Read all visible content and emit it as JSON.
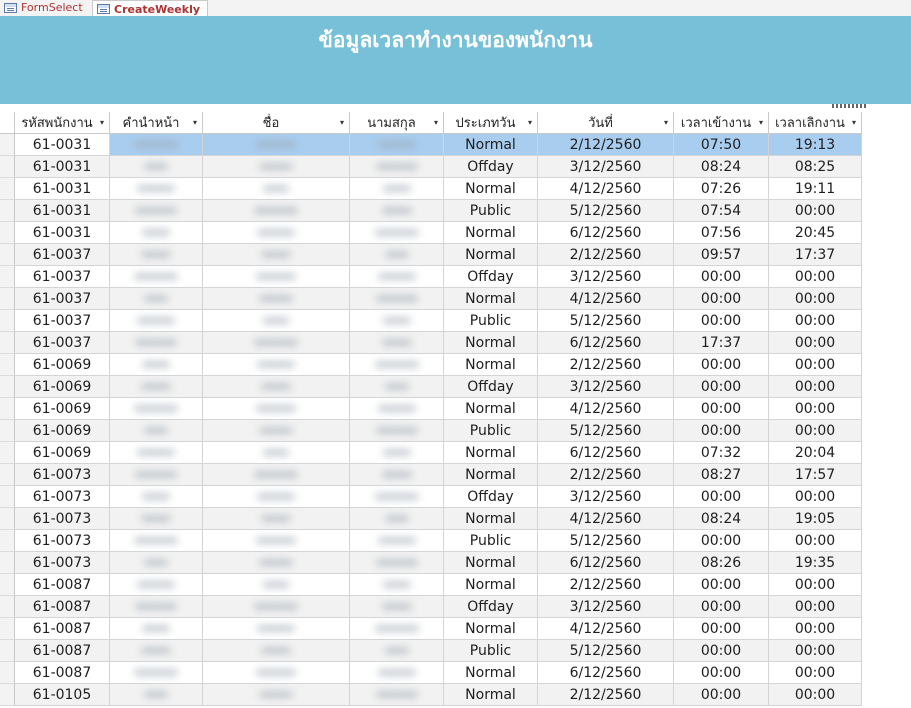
{
  "tabs": [
    {
      "label": "FormSelect",
      "active": false
    },
    {
      "label": "CreateWeekly",
      "active": true
    }
  ],
  "header": {
    "title": "ข้อมูลเวลาทำงานของพนักงาน",
    "background": "#78c0d7"
  },
  "columns": [
    "รหัสพนักงาน",
    "คำนำหน้า",
    "ชื่อ",
    "นามสกุล",
    "ประเภทวัน",
    "วันที่",
    "เวลาเข้างาน",
    "เวลาเลิกงาน"
  ],
  "rows": [
    {
      "id": "61-0031",
      "type": "Normal",
      "date": "2/12/2560",
      "in": "07:50",
      "out": "19:13"
    },
    {
      "id": "61-0031",
      "type": "Offday",
      "date": "3/12/2560",
      "in": "08:24",
      "out": "08:25"
    },
    {
      "id": "61-0031",
      "type": "Normal",
      "date": "4/12/2560",
      "in": "07:26",
      "out": "19:11"
    },
    {
      "id": "61-0031",
      "type": "Public",
      "date": "5/12/2560",
      "in": "07:54",
      "out": "00:00"
    },
    {
      "id": "61-0031",
      "type": "Normal",
      "date": "6/12/2560",
      "in": "07:56",
      "out": "20:45"
    },
    {
      "id": "61-0037",
      "type": "Normal",
      "date": "2/12/2560",
      "in": "09:57",
      "out": "17:37"
    },
    {
      "id": "61-0037",
      "type": "Offday",
      "date": "3/12/2560",
      "in": "00:00",
      "out": "00:00"
    },
    {
      "id": "61-0037",
      "type": "Normal",
      "date": "4/12/2560",
      "in": "00:00",
      "out": "00:00"
    },
    {
      "id": "61-0037",
      "type": "Public",
      "date": "5/12/2560",
      "in": "00:00",
      "out": "00:00"
    },
    {
      "id": "61-0037",
      "type": "Normal",
      "date": "6/12/2560",
      "in": "17:37",
      "out": "00:00"
    },
    {
      "id": "61-0069",
      "type": "Normal",
      "date": "2/12/2560",
      "in": "00:00",
      "out": "00:00"
    },
    {
      "id": "61-0069",
      "type": "Offday",
      "date": "3/12/2560",
      "in": "00:00",
      "out": "00:00"
    },
    {
      "id": "61-0069",
      "type": "Normal",
      "date": "4/12/2560",
      "in": "00:00",
      "out": "00:00"
    },
    {
      "id": "61-0069",
      "type": "Public",
      "date": "5/12/2560",
      "in": "00:00",
      "out": "00:00"
    },
    {
      "id": "61-0069",
      "type": "Normal",
      "date": "6/12/2560",
      "in": "07:32",
      "out": "20:04"
    },
    {
      "id": "61-0073",
      "type": "Normal",
      "date": "2/12/2560",
      "in": "08:27",
      "out": "17:57"
    },
    {
      "id": "61-0073",
      "type": "Offday",
      "date": "3/12/2560",
      "in": "00:00",
      "out": "00:00"
    },
    {
      "id": "61-0073",
      "type": "Normal",
      "date": "4/12/2560",
      "in": "08:24",
      "out": "19:05"
    },
    {
      "id": "61-0073",
      "type": "Public",
      "date": "5/12/2560",
      "in": "00:00",
      "out": "00:00"
    },
    {
      "id": "61-0073",
      "type": "Normal",
      "date": "6/12/2560",
      "in": "08:26",
      "out": "19:35"
    },
    {
      "id": "61-0087",
      "type": "Normal",
      "date": "2/12/2560",
      "in": "00:00",
      "out": "00:00"
    },
    {
      "id": "61-0087",
      "type": "Offday",
      "date": "3/12/2560",
      "in": "00:00",
      "out": "00:00"
    },
    {
      "id": "61-0087",
      "type": "Normal",
      "date": "4/12/2560",
      "in": "00:00",
      "out": "00:00"
    },
    {
      "id": "61-0087",
      "type": "Public",
      "date": "5/12/2560",
      "in": "00:00",
      "out": "00:00"
    },
    {
      "id": "61-0087",
      "type": "Normal",
      "date": "6/12/2560",
      "in": "00:00",
      "out": "00:00"
    },
    {
      "id": "61-0105",
      "type": "Normal",
      "date": "2/12/2560",
      "in": "00:00",
      "out": "00:00"
    }
  ],
  "colors": {
    "selected_row": "#a9cdef",
    "alt_row": "#f2f2f2"
  }
}
